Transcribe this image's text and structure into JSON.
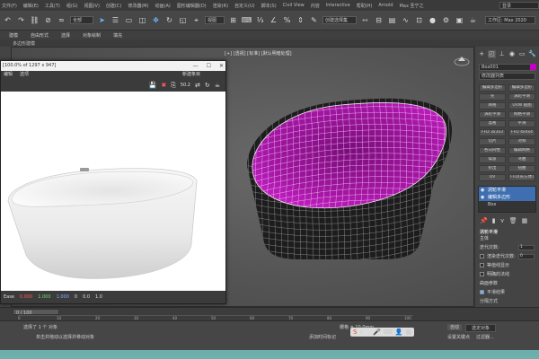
{
  "menubar": {
    "items": [
      "文件(F)",
      "编辑(E)",
      "工具(T)",
      "组(G)",
      "视图(V)",
      "创建(C)",
      "修改器(M)",
      "动画(A)",
      "图形编辑器(D)",
      "渲染(R)",
      "自定义(U)",
      "脚本(S)",
      "Civil View",
      "内容",
      "Interactive",
      "帮助(H)",
      "Arnold",
      "Max 圣宁之"
    ],
    "search_label": "登录"
  },
  "toolbar": {
    "dropdown_all": "全部",
    "dropdown_view": "视图",
    "dropdown_selset": "创建选择集",
    "workspace": "工作区: Max 2020"
  },
  "ribbon": {
    "tabs": [
      "建模",
      "自由形式",
      "选择",
      "对象绘制",
      "填充"
    ],
    "sub": "多边形建模"
  },
  "viewport": {
    "label": "[+] [透视] [标准] [默认明暗处理]"
  },
  "image_window": {
    "title": "[100.0% of 1297 x 947]",
    "menu": [
      "编辑",
      "选项"
    ],
    "right_label": "新建条目",
    "zoom_value": "50.2",
    "footer": [
      "Ease",
      "0.000",
      "1.000",
      "1.000",
      "0",
      "0.0",
      "1.0"
    ]
  },
  "cmdpanel": {
    "object_name": "Box001",
    "modifier_list": "修改器列表",
    "buttons": [
      "编辑多边形",
      "编辑多边形",
      "壳",
      "涡轮平滑",
      "网格",
      "UVW 贴图",
      "涡轮平滑",
      "网格平滑",
      "晶格",
      "平滑",
      "FFD 3x3x3",
      "FFD 4x4x4",
      "切片",
      "对称",
      "各向同性",
      "编辑网格",
      "噪波",
      "弯曲",
      "挤出",
      "扭曲",
      "UV",
      "FFD(长方体)"
    ],
    "stack": [
      "涡轮平滑",
      "编辑多边形",
      "Box"
    ],
    "section_title": "涡轮平滑",
    "main_label": "主体",
    "iterations_label": "迭代次数:",
    "iterations_value": "1",
    "render_iter_label": "渲染迭代次数:",
    "render_iter_value": "0",
    "isoline_label": "等值线显示",
    "explicit_label": "明确的法线",
    "surface_label": "曲面参数",
    "smooth_label": "平滑结果",
    "separate_label": "分隔方式"
  },
  "timeline": {
    "frame": "0 / 100",
    "tick_labels": [
      "0",
      "10",
      "20",
      "30",
      "40",
      "50",
      "60",
      "70",
      "80",
      "90",
      "100"
    ]
  },
  "statusbar": {
    "selected": "选择了 1 个 对象",
    "hint": "单击并拖动以选择并移动对象",
    "grid": "栅格 = 10.0mm",
    "add_key": "添加时间标记",
    "autokey": "自动",
    "selected_obj": "选定对象",
    "setkey": "设置关键点",
    "filter": "过滤器..."
  },
  "colors": {
    "mesh": "#c400c4",
    "accent": "#3f6fb0"
  }
}
